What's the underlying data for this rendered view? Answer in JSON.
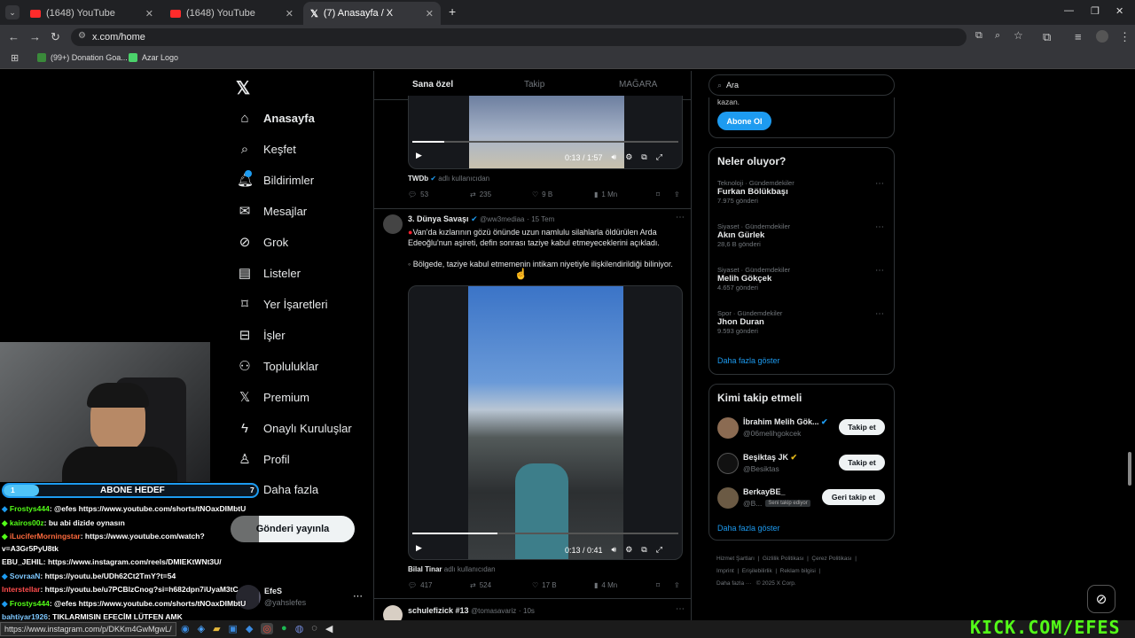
{
  "browser": {
    "tabs": [
      {
        "label": "(1648) YouTube"
      },
      {
        "label": "(1648) YouTube"
      },
      {
        "label": "(7) Anasayfa / X"
      }
    ],
    "url": "x.com/home",
    "bookmarks": [
      {
        "label": "(99+) Donation Goa..."
      },
      {
        "label": "Azar Logo"
      }
    ],
    "status_url": "https://www.instagram.com/p/DKKm4GwMgwL/"
  },
  "nav": {
    "items": [
      {
        "label": "Anasayfa"
      },
      {
        "label": "Keşfet"
      },
      {
        "label": "Bildirimler"
      },
      {
        "label": "Mesajlar"
      },
      {
        "label": "Grok"
      },
      {
        "label": "Listeler"
      },
      {
        "label": "Yer İşaretleri"
      },
      {
        "label": "İşler"
      },
      {
        "label": "Topluluklar"
      },
      {
        "label": "Premium"
      },
      {
        "label": "Onaylı Kuruluşlar"
      },
      {
        "label": "Profil"
      },
      {
        "label": "Daha fazla"
      }
    ],
    "post_label": "Gönderi yayınla",
    "account_name": "EfeS",
    "account_handle": "@yahslefes"
  },
  "feed": {
    "tabs": {
      "for_you": "Sana özel",
      "following": "Takip",
      "store": "MAĞARA"
    },
    "post1": {
      "time": "0:13 / 1:57",
      "source": "TWDb",
      "source_suffix": "adlı kullanıcıdan",
      "replies": "53",
      "reposts": "235",
      "likes": "9 B",
      "views": "1 Mn"
    },
    "post2": {
      "author": "3. Dünya Savaşı",
      "handle": "@ww3mediaa",
      "date": "15 Tem",
      "text1": "Van'da kızlarının gözü önünde uzun namlulu silahlarla öldürülen Arda Edeoğlu'nun aşireti, defin sonrası taziye kabul etmeyeceklerini açıkladı.",
      "text2": "Bölgede, taziye kabul etmemenin intikam niyetiyle ilişkilendirildiği biliniyor.",
      "time": "0:13 / 0:41",
      "source": "Bilal Tinar",
      "source_suffix": "adlı kullanıcıdan",
      "replies": "417",
      "reposts": "524",
      "likes": "17 B",
      "views": "4 Mn"
    },
    "post3": {
      "author": "schulefizick #13",
      "handle": "@tomasavariz",
      "date": "10s"
    }
  },
  "right": {
    "search_placeholder": "Ara",
    "sub_partial": "kazan.",
    "subscribe_label": "Abone Ol",
    "trends_title": "Neler oluyor?",
    "trends": [
      {
        "cat": "Teknoloji · Gündemdekiler",
        "name": "Furkan Bölükbaşı",
        "count": "7.975 gönderi"
      },
      {
        "cat": "Siyaset · Gündemdekiler",
        "name": "Akın Gürlek",
        "count": "28,6 B gönderi"
      },
      {
        "cat": "Siyaset · Gündemdekiler",
        "name": "Melih Gökçek",
        "count": "4.657 gönderi"
      },
      {
        "cat": "Spor · Gündemdekiler",
        "name": "Jhon Duran",
        "count": "9.593 gönderi"
      }
    ],
    "show_more": "Daha fazla göster",
    "who_title": "Kimi takip etmeli",
    "who": [
      {
        "name": "İbrahim Melih Gök...",
        "handle": "@06melihgokcek",
        "btn": "Takip et"
      },
      {
        "name": "Beşiktaş JK",
        "handle": "@Besiktas",
        "btn": "Takip et"
      },
      {
        "name": "BerkayBE_",
        "handle": "@B...",
        "badge": "Seni takip ediyor",
        "btn": "Geri takip et"
      }
    ],
    "who_more": "Daha fazla göster",
    "footer": [
      "Hizmet Şartları",
      "Gizlilik Politikası",
      "Çerez Politikası",
      "Imprint",
      "Erişilebilirlik",
      "Reklam bilgisi",
      "Daha fazla ···",
      "© 2025 X Corp."
    ]
  },
  "stream": {
    "goal_current": "1",
    "goal_label": "ABONE HEDEF",
    "goal_target": "7",
    "chat": [
      {
        "user": "Frostys444",
        "msg": ": @efes https://www.youtube.com/shorts/tNOaxDIMbtU"
      },
      {
        "user": "kairos00z",
        "msg": ": bu abi dizide oynasın"
      },
      {
        "user": "iLuciferMorningstar",
        "msg": ": https://www.youtube.com/watch?"
      },
      {
        "user": "",
        "msg": "v=A3Gr5PyU8tk"
      },
      {
        "user": "EBU_JEHIL",
        "msg": ": https://www.instagram.com/reels/DMIEKtWNt3U/"
      },
      {
        "user": "SovraaN",
        "msg": ": https://youtu.be/UDh62Ct2TmY?t=54"
      },
      {
        "user": "Interstellar",
        "msg": ": https://youtu.be/u7PCBlzCnog?si=h682dpn7iUyaM3tC"
      },
      {
        "user": "Frostys444",
        "msg": ": @efes https://www.youtube.com/shorts/tNOaxDIMbtU"
      },
      {
        "user": "bahtiyar1926",
        "msg": ": TIKLARMISIN EFECİM LÜTFEN AMK"
      }
    ],
    "watermark": "KICK.COM/EFES"
  },
  "colors": {
    "accent": "#1d9bf0",
    "kick": "#53fc18",
    "bg": "#000000"
  }
}
